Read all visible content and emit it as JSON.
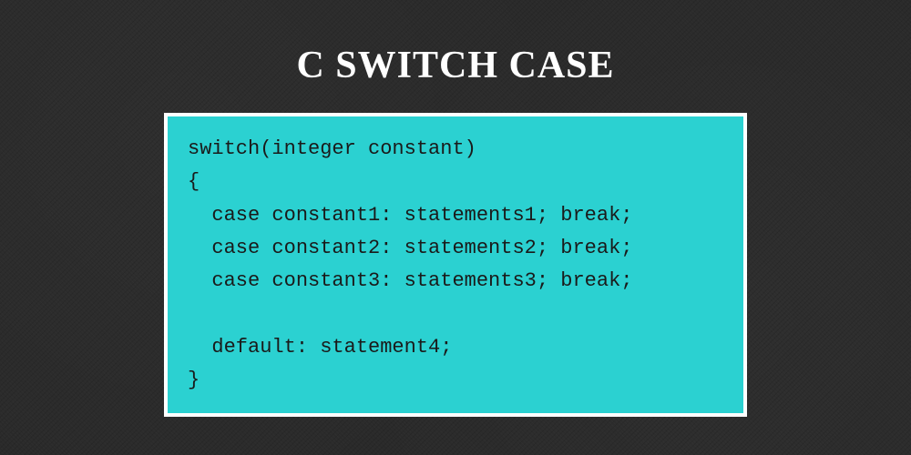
{
  "title": "C SWITCH CASE",
  "code": "switch(integer constant)\n{\n  case constant1: statements1; break;\n  case constant2: statements2; break;\n  case constant3: statements3; break;\n\n  default: statement4;\n}"
}
